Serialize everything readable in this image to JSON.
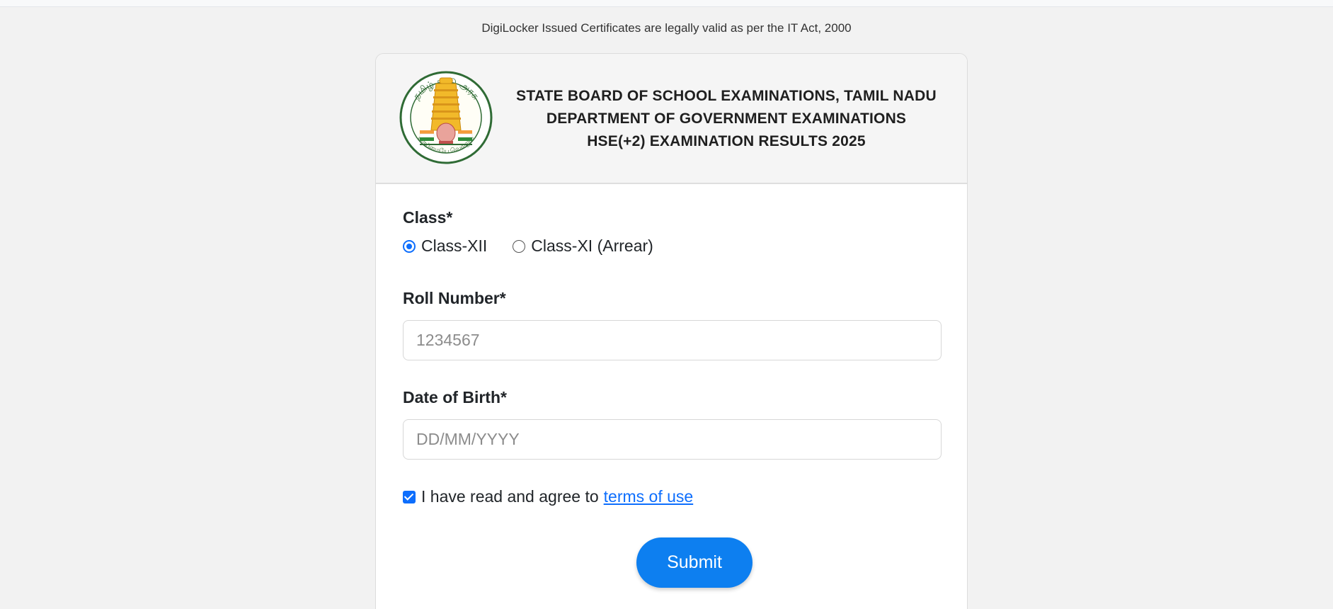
{
  "page": {
    "legal_note": "DigiLocker Issued Certificates are legally valid as per the IT Act, 2000"
  },
  "header": {
    "line1": "STATE BOARD OF SCHOOL EXAMINATIONS, TAMIL NADU",
    "line2": "DEPARTMENT OF GOVERNMENT EXAMINATIONS",
    "line3": "HSE(+2) EXAMINATION RESULTS 2025",
    "emblem": {
      "icon": "tamil-nadu-emblem-icon",
      "top_text": "தமிழ் நாடு அரசு",
      "bottom_text": "வாய்மையே வெல்லும்"
    }
  },
  "form": {
    "class_label": "Class*",
    "class_options": [
      {
        "label": "Class-XII",
        "selected": true
      },
      {
        "label": "Class-XI (Arrear)",
        "selected": false
      }
    ],
    "roll_label": "Roll Number*",
    "roll_value": "",
    "roll_placeholder": "1234567",
    "dob_label": "Date of Birth*",
    "dob_value": "",
    "dob_placeholder": "DD/MM/YYYY",
    "terms_text": "I have read and agree to",
    "terms_link": "terms of use",
    "terms_checked": true,
    "submit_label": "Submit"
  },
  "colors": {
    "accent": "#0d6efd",
    "submit_bg": "#0d7ff0",
    "page_bg": "#f2f2f2"
  }
}
